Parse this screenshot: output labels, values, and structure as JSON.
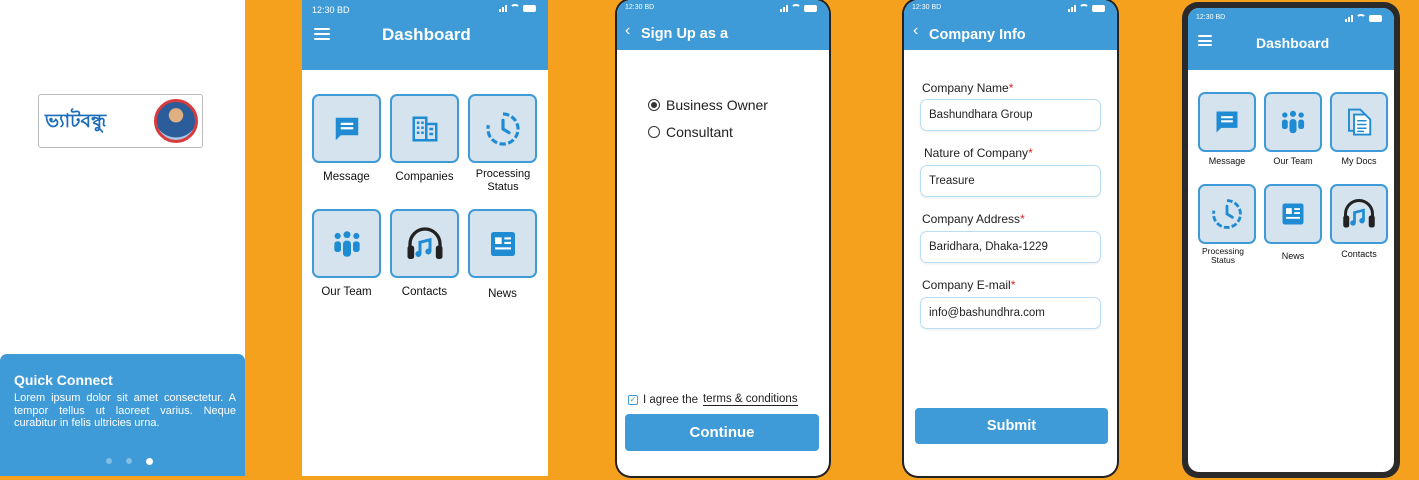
{
  "background_color": "#F5A11D",
  "accent_color": "#3E9BD7",
  "splash": {
    "logo_text": "ভ্যাটবন্ধু",
    "quick_connect": {
      "title": "Quick Connect",
      "body": "Lorem ipsum dolor sit amet consectetur. A tempor tellus ut laoreet varius. Neque curabitur in felis ultricies urna.",
      "page_indicator": {
        "pages": 3,
        "active": 3
      }
    }
  },
  "dashboard1": {
    "time": "12:30",
    "carrier": "BD",
    "title": "Dashboard",
    "tiles": [
      {
        "label": "Message",
        "icon": "message-icon"
      },
      {
        "label": "Companies",
        "icon": "building-icon"
      },
      {
        "label": "Processing Status",
        "icon": "clock-icon"
      },
      {
        "label": "Our Team",
        "icon": "team-icon"
      },
      {
        "label": "Contacts",
        "icon": "headphones-icon"
      },
      {
        "label": "News",
        "icon": "news-icon"
      }
    ]
  },
  "signup": {
    "time": "12:30",
    "carrier": "BD",
    "title": "Sign Up as a",
    "options": [
      {
        "label": "Business Owner",
        "selected": true
      },
      {
        "label": "Consultant",
        "selected": false
      }
    ],
    "agree_prefix": "I agree the",
    "agree_link": "terms & conditions",
    "agree_checked": true,
    "continue_label": "Continue"
  },
  "company": {
    "time": "12:30",
    "carrier": "BD",
    "title": "Company Info",
    "fields": [
      {
        "label": "Company Name",
        "value": "Bashundhara Group"
      },
      {
        "label": "Nature of Company",
        "value": "Treasure"
      },
      {
        "label": "Company Address",
        "value": "Baridhara, Dhaka-1229"
      },
      {
        "label": "Company E-mail",
        "value": "info@bashundhra.com"
      }
    ],
    "required_mark": "*",
    "submit_label": "Submit"
  },
  "dashboard2": {
    "time": "12:30",
    "carrier": "BD",
    "title": "Dashboard",
    "tiles": [
      {
        "label": "Message",
        "icon": "message-icon"
      },
      {
        "label": "Our Team",
        "icon": "team-icon"
      },
      {
        "label": "My Docs",
        "icon": "document-icon"
      },
      {
        "label": "Processing Status",
        "icon": "clock-icon"
      },
      {
        "label": "News",
        "icon": "news-icon"
      },
      {
        "label": "Contacts",
        "icon": "headphones-icon"
      }
    ]
  }
}
